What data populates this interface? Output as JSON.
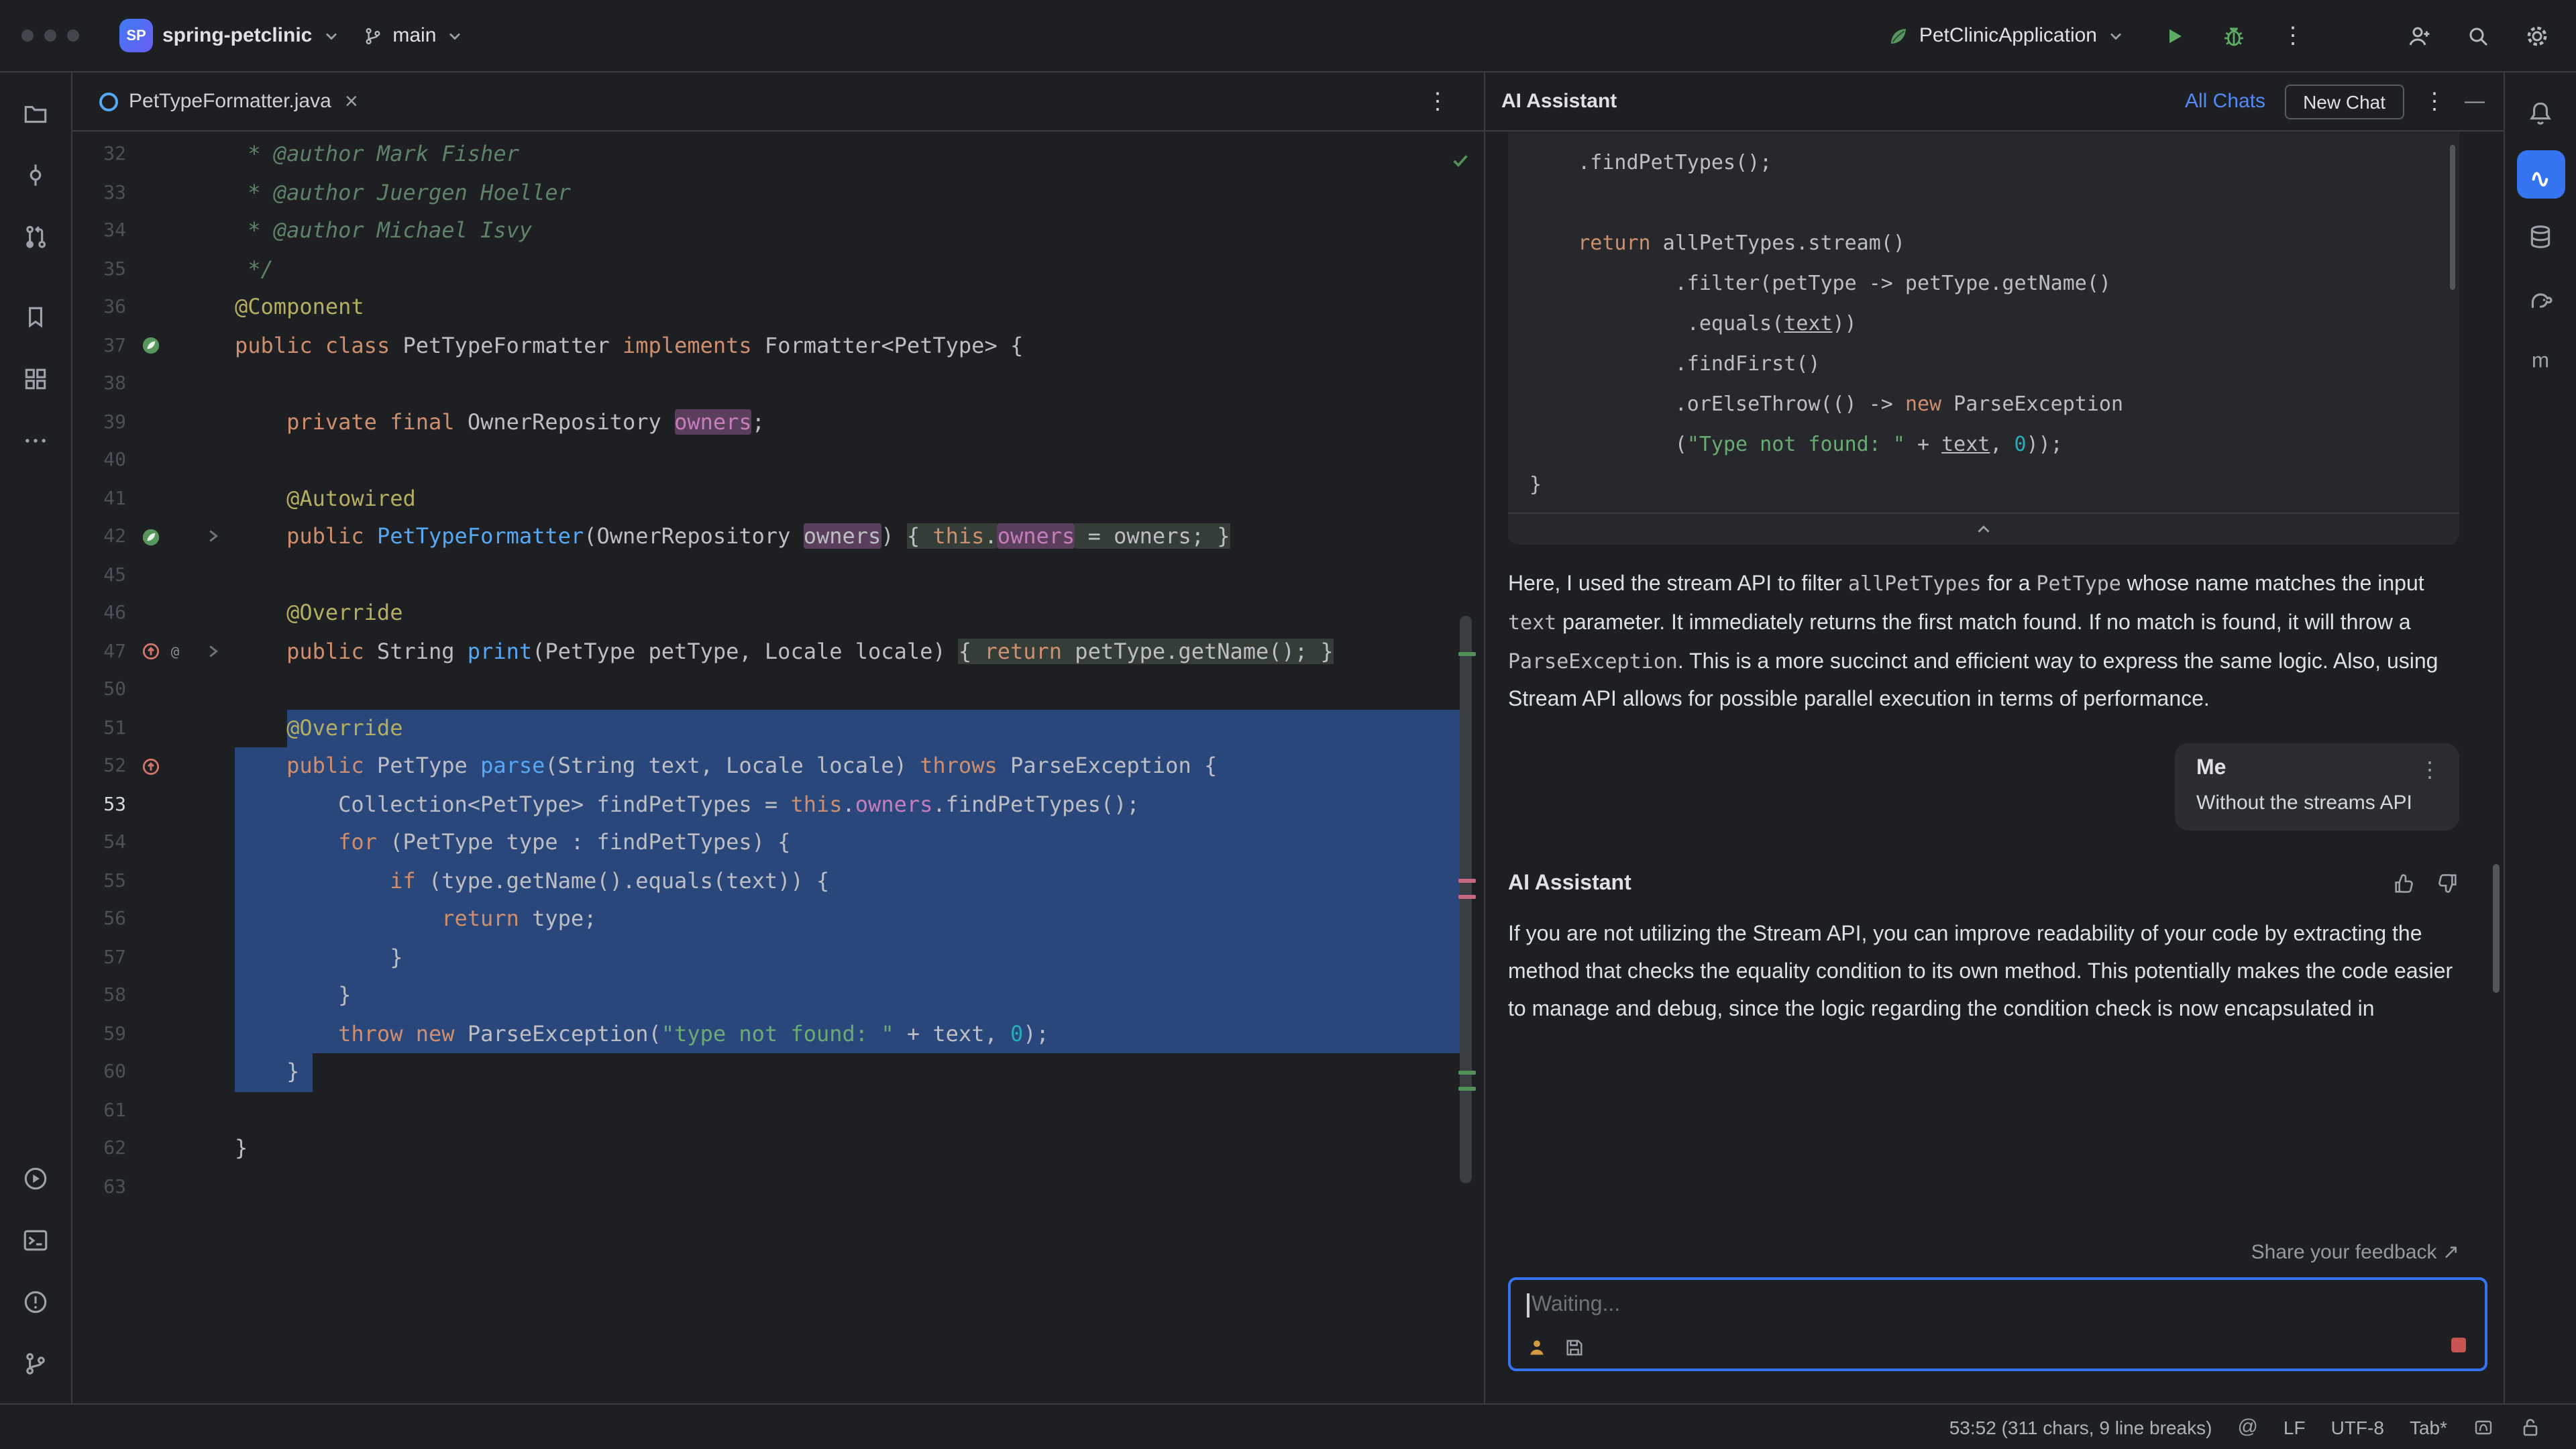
{
  "colors": {
    "accent_blue": "#3574F0",
    "selection_blue": "#2A477C",
    "run_green": "#5CAD63",
    "stop_red": "#C75450",
    "usage_highlight": "#5A3F5C"
  },
  "glyphs": {
    "kebab": "⋮",
    "minimize": "—",
    "close": "×",
    "external_arrow": "↗"
  },
  "topbar": {
    "project_badge": "SP",
    "project": "spring-petclinic",
    "branch": "main",
    "run_config": "PetClinicApplication"
  },
  "left_stripe": {
    "top": [
      {
        "name": "project",
        "icon": "folder"
      },
      {
        "name": "commit",
        "icon": "commit"
      },
      {
        "name": "pull-requests",
        "icon": "pr"
      },
      {
        "name": "bookmarks",
        "icon": "bookmark",
        "gap": true
      },
      {
        "name": "structure",
        "icon": "structure"
      },
      {
        "name": "more-tools",
        "icon": "more"
      }
    ],
    "bottom": [
      {
        "name": "services",
        "icon": "run"
      },
      {
        "name": "terminal",
        "icon": "terminal"
      },
      {
        "name": "problems",
        "icon": "problems"
      },
      {
        "name": "version-control",
        "icon": "branch"
      }
    ]
  },
  "right_stripe": {
    "top": [
      {
        "name": "notifications",
        "icon": "bell"
      },
      {
        "name": "ai-assistant",
        "icon": "ai",
        "active": true
      },
      {
        "name": "database",
        "icon": "db"
      },
      {
        "name": "gradle",
        "icon": "gradle"
      },
      {
        "name": "maven",
        "icon": "maven"
      }
    ]
  },
  "editor": {
    "tab_title": "PetTypeFormatter.java",
    "lines": [
      {
        "num": "32",
        "t": [
          [
            " * @author Mark Fisher",
            "cm"
          ]
        ]
      },
      {
        "num": "33",
        "t": [
          [
            " * @author Juergen Hoeller",
            "cm"
          ]
        ]
      },
      {
        "num": "34",
        "t": [
          [
            " * @author Michael Isvy",
            "cm"
          ]
        ]
      },
      {
        "num": "35",
        "t": [
          [
            " */",
            "cm"
          ]
        ]
      },
      {
        "num": "36",
        "t": [
          [
            "@Component",
            "ann"
          ]
        ]
      },
      {
        "num": "37",
        "icons": [
          "spring"
        ],
        "t": [
          [
            "public",
            "kw"
          ],
          [
            " ",
            "pl"
          ],
          [
            "class",
            "kw"
          ],
          [
            " PetTypeFormatter ",
            "pl"
          ],
          [
            "implements",
            "kw"
          ],
          [
            " Formatter<PetType> {",
            "pl"
          ]
        ]
      },
      {
        "num": "38",
        "t": []
      },
      {
        "num": "39",
        "t": [
          [
            "    ",
            "pl"
          ],
          [
            "private",
            "kw"
          ],
          [
            " ",
            "pl"
          ],
          [
            "final",
            "kw"
          ],
          [
            " OwnerRepository ",
            "pl"
          ],
          [
            "owners",
            "fld hl"
          ],
          [
            ";",
            "pl"
          ]
        ]
      },
      {
        "num": "40",
        "t": []
      },
      {
        "num": "41",
        "t": [
          [
            "    ",
            "pl"
          ],
          [
            "@Autowired",
            "ann"
          ]
        ]
      },
      {
        "num": "42",
        "icons": [
          "spring"
        ],
        "fold": true,
        "t": [
          [
            "    ",
            "pl"
          ],
          [
            "public",
            "kw"
          ],
          [
            " ",
            "pl"
          ],
          [
            "PetTypeFormatter",
            "mth"
          ],
          [
            "(OwnerRepository ",
            "pl"
          ],
          [
            "owners",
            "pl hl"
          ],
          [
            ") ",
            "pl"
          ],
          [
            "{ ",
            "pl fb"
          ],
          [
            "this",
            "kw fb"
          ],
          [
            ".",
            "pl fb"
          ],
          [
            "owners",
            "fld hl"
          ],
          [
            " = ",
            "pl fb"
          ],
          [
            "owners",
            "pl fb"
          ],
          [
            "; }",
            "pl fb"
          ]
        ]
      },
      {
        "num": "45",
        "t": []
      },
      {
        "num": "46",
        "t": [
          [
            "    ",
            "pl"
          ],
          [
            "@Override",
            "ann"
          ]
        ]
      },
      {
        "num": "47",
        "icons": [
          "override",
          "at"
        ],
        "fold": true,
        "t": [
          [
            "    ",
            "pl"
          ],
          [
            "public",
            "kw"
          ],
          [
            " String ",
            "pl"
          ],
          [
            "print",
            "mth"
          ],
          [
            "(PetType petType, Locale locale) ",
            "pl"
          ],
          [
            "{ ",
            "pl fb"
          ],
          [
            "return",
            "kw fb"
          ],
          [
            " petType.getName(); }",
            "pl fb"
          ]
        ]
      },
      {
        "num": "50",
        "t": []
      },
      {
        "num": "51",
        "sel": [
          4,
          null
        ],
        "t": [
          [
            "    ",
            "pl"
          ],
          [
            "@Override",
            "ann"
          ]
        ]
      },
      {
        "num": "52",
        "icons": [
          "override"
        ],
        "sel": [
          0,
          null
        ],
        "t": [
          [
            "    ",
            "pl"
          ],
          [
            "public",
            "kw"
          ],
          [
            " PetType ",
            "pl"
          ],
          [
            "parse",
            "mth"
          ],
          [
            "(String text, Locale locale) ",
            "pl"
          ],
          [
            "throws",
            "kw"
          ],
          [
            " ParseException {",
            "pl"
          ]
        ]
      },
      {
        "num": "53",
        "caret": true,
        "sel": [
          0,
          null
        ],
        "t": [
          [
            "        Collection<PetType> findPetTypes = ",
            "pl"
          ],
          [
            "this",
            "kw"
          ],
          [
            ".",
            "pl"
          ],
          [
            "owners",
            "fld"
          ],
          [
            ".findPetTypes();",
            "pl"
          ]
        ]
      },
      {
        "num": "54",
        "sel": [
          0,
          null
        ],
        "t": [
          [
            "        ",
            "pl"
          ],
          [
            "for",
            "kw"
          ],
          [
            " (PetType type : findPetTypes) {",
            "pl"
          ]
        ]
      },
      {
        "num": "55",
        "sel": [
          0,
          null
        ],
        "t": [
          [
            "            ",
            "pl"
          ],
          [
            "if",
            "kw"
          ],
          [
            " (type.getName().equals(text)) {",
            "pl"
          ]
        ]
      },
      {
        "num": "56",
        "sel": [
          0,
          null
        ],
        "t": [
          [
            "                ",
            "pl"
          ],
          [
            "return",
            "kw"
          ],
          [
            " type;",
            "pl"
          ]
        ]
      },
      {
        "num": "57",
        "sel": [
          0,
          null
        ],
        "t": [
          [
            "            }",
            "pl"
          ]
        ]
      },
      {
        "num": "58",
        "sel": [
          0,
          null
        ],
        "t": [
          [
            "        }",
            "pl"
          ]
        ]
      },
      {
        "num": "59",
        "sel": [
          0,
          null
        ],
        "t": [
          [
            "        ",
            "pl"
          ],
          [
            "throw",
            "kw"
          ],
          [
            " ",
            "pl"
          ],
          [
            "new",
            "kw"
          ],
          [
            " ParseException(",
            "pl"
          ],
          [
            "\"type not found: \"",
            "str"
          ],
          [
            " + text, ",
            "pl"
          ],
          [
            "0",
            "num"
          ],
          [
            ");",
            "pl"
          ]
        ]
      },
      {
        "num": "60",
        "sel": [
          0,
          6
        ],
        "t": [
          [
            "    }",
            "pl"
          ]
        ]
      },
      {
        "num": "61",
        "t": []
      },
      {
        "num": "62",
        "t": [
          [
            "}",
            "pl"
          ]
        ]
      },
      {
        "num": "63",
        "t": []
      }
    ]
  },
  "ai": {
    "title": "AI Assistant",
    "all_chats": "All Chats",
    "new_chat": "New Chat",
    "code_lines": [
      [
        [
          "    .findPetTypes();",
          "pl"
        ]
      ],
      [],
      [
        [
          "    ",
          "pl"
        ],
        [
          "return",
          "kw"
        ],
        [
          " allPetTypes.stream()",
          "pl"
        ]
      ],
      [
        [
          "            .filter(petType -> petType.getName()",
          "pl"
        ]
      ],
      [
        [
          "             .equals(",
          "pl"
        ],
        [
          "text",
          "pl ul"
        ],
        [
          "))",
          "pl"
        ]
      ],
      [
        [
          "            .findFirst()",
          "pl"
        ]
      ],
      [
        [
          "            .orElseThrow(() -> ",
          "pl"
        ],
        [
          "new",
          "kw"
        ],
        [
          " ParseException",
          "pl"
        ]
      ],
      [
        [
          "            (",
          "pl"
        ],
        [
          "\"Type not found: \"",
          "str"
        ],
        [
          " + ",
          "pl"
        ],
        [
          "text",
          "pl ul"
        ],
        [
          ", ",
          "pl"
        ],
        [
          "0",
          "num"
        ],
        [
          "));",
          "pl"
        ]
      ],
      [
        [
          "}",
          "pl"
        ]
      ]
    ],
    "para1": [
      {
        "t": "Here, I used the stream API to filter "
      },
      {
        "t": "allPetTypes",
        "code": true
      },
      {
        "t": " for a "
      },
      {
        "t": "PetType",
        "code": true
      },
      {
        "t": " whose name matches the input "
      },
      {
        "t": "text",
        "code": true
      },
      {
        "t": " parameter. It immediately returns the first match found. If no match is found, it will throw a "
      },
      {
        "t": "ParseException",
        "code": true
      },
      {
        "t": ". This is a more succinct and efficient way to express the same logic. Also, using Stream API allows for possible parallel execution in terms of performance."
      }
    ],
    "me": {
      "name": "Me",
      "text": "Without the streams API"
    },
    "assistant_name": "AI Assistant",
    "para2": "If you are not utilizing the Stream API, you can improve readability of your code by extracting the method that checks the equality condition to its own method. This potentially makes the code easier to manage and debug, since the logic regarding the condition check is now encapsulated in",
    "feedback": "Share your feedback",
    "input_placeholder": "Waiting..."
  },
  "statusbar": {
    "position": "53:52 (311 chars, 9 line breaks)",
    "at_indicator": "@",
    "line_separator": "LF",
    "encoding": "UTF-8",
    "indent": "Tab*"
  }
}
